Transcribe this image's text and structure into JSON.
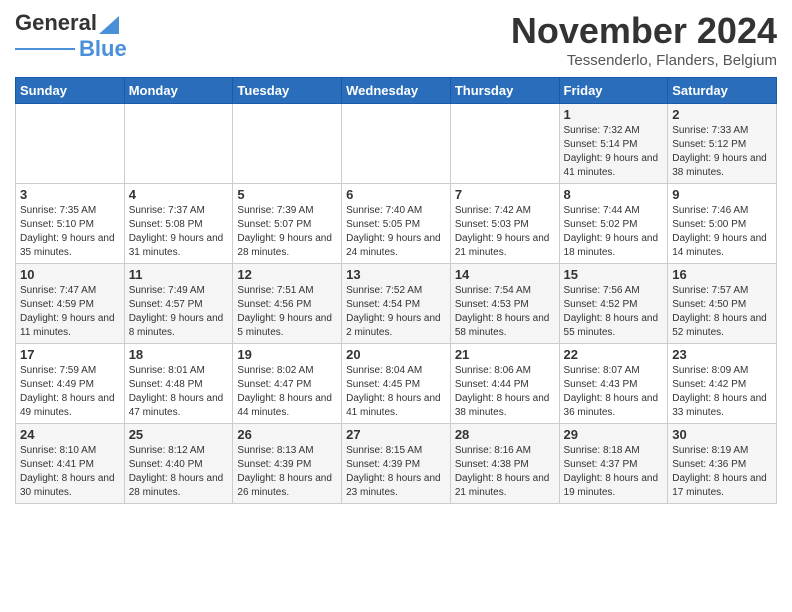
{
  "header": {
    "logo_general": "General",
    "logo_blue": "Blue",
    "month_title": "November 2024",
    "location": "Tessenderlo, Flanders, Belgium"
  },
  "days_of_week": [
    "Sunday",
    "Monday",
    "Tuesday",
    "Wednesday",
    "Thursday",
    "Friday",
    "Saturday"
  ],
  "weeks": [
    [
      {
        "day": "",
        "info": ""
      },
      {
        "day": "",
        "info": ""
      },
      {
        "day": "",
        "info": ""
      },
      {
        "day": "",
        "info": ""
      },
      {
        "day": "",
        "info": ""
      },
      {
        "day": "1",
        "info": "Sunrise: 7:32 AM\nSunset: 5:14 PM\nDaylight: 9 hours and 41 minutes."
      },
      {
        "day": "2",
        "info": "Sunrise: 7:33 AM\nSunset: 5:12 PM\nDaylight: 9 hours and 38 minutes."
      }
    ],
    [
      {
        "day": "3",
        "info": "Sunrise: 7:35 AM\nSunset: 5:10 PM\nDaylight: 9 hours and 35 minutes."
      },
      {
        "day": "4",
        "info": "Sunrise: 7:37 AM\nSunset: 5:08 PM\nDaylight: 9 hours and 31 minutes."
      },
      {
        "day": "5",
        "info": "Sunrise: 7:39 AM\nSunset: 5:07 PM\nDaylight: 9 hours and 28 minutes."
      },
      {
        "day": "6",
        "info": "Sunrise: 7:40 AM\nSunset: 5:05 PM\nDaylight: 9 hours and 24 minutes."
      },
      {
        "day": "7",
        "info": "Sunrise: 7:42 AM\nSunset: 5:03 PM\nDaylight: 9 hours and 21 minutes."
      },
      {
        "day": "8",
        "info": "Sunrise: 7:44 AM\nSunset: 5:02 PM\nDaylight: 9 hours and 18 minutes."
      },
      {
        "day": "9",
        "info": "Sunrise: 7:46 AM\nSunset: 5:00 PM\nDaylight: 9 hours and 14 minutes."
      }
    ],
    [
      {
        "day": "10",
        "info": "Sunrise: 7:47 AM\nSunset: 4:59 PM\nDaylight: 9 hours and 11 minutes."
      },
      {
        "day": "11",
        "info": "Sunrise: 7:49 AM\nSunset: 4:57 PM\nDaylight: 9 hours and 8 minutes."
      },
      {
        "day": "12",
        "info": "Sunrise: 7:51 AM\nSunset: 4:56 PM\nDaylight: 9 hours and 5 minutes."
      },
      {
        "day": "13",
        "info": "Sunrise: 7:52 AM\nSunset: 4:54 PM\nDaylight: 9 hours and 2 minutes."
      },
      {
        "day": "14",
        "info": "Sunrise: 7:54 AM\nSunset: 4:53 PM\nDaylight: 8 hours and 58 minutes."
      },
      {
        "day": "15",
        "info": "Sunrise: 7:56 AM\nSunset: 4:52 PM\nDaylight: 8 hours and 55 minutes."
      },
      {
        "day": "16",
        "info": "Sunrise: 7:57 AM\nSunset: 4:50 PM\nDaylight: 8 hours and 52 minutes."
      }
    ],
    [
      {
        "day": "17",
        "info": "Sunrise: 7:59 AM\nSunset: 4:49 PM\nDaylight: 8 hours and 49 minutes."
      },
      {
        "day": "18",
        "info": "Sunrise: 8:01 AM\nSunset: 4:48 PM\nDaylight: 8 hours and 47 minutes."
      },
      {
        "day": "19",
        "info": "Sunrise: 8:02 AM\nSunset: 4:47 PM\nDaylight: 8 hours and 44 minutes."
      },
      {
        "day": "20",
        "info": "Sunrise: 8:04 AM\nSunset: 4:45 PM\nDaylight: 8 hours and 41 minutes."
      },
      {
        "day": "21",
        "info": "Sunrise: 8:06 AM\nSunset: 4:44 PM\nDaylight: 8 hours and 38 minutes."
      },
      {
        "day": "22",
        "info": "Sunrise: 8:07 AM\nSunset: 4:43 PM\nDaylight: 8 hours and 36 minutes."
      },
      {
        "day": "23",
        "info": "Sunrise: 8:09 AM\nSunset: 4:42 PM\nDaylight: 8 hours and 33 minutes."
      }
    ],
    [
      {
        "day": "24",
        "info": "Sunrise: 8:10 AM\nSunset: 4:41 PM\nDaylight: 8 hours and 30 minutes."
      },
      {
        "day": "25",
        "info": "Sunrise: 8:12 AM\nSunset: 4:40 PM\nDaylight: 8 hours and 28 minutes."
      },
      {
        "day": "26",
        "info": "Sunrise: 8:13 AM\nSunset: 4:39 PM\nDaylight: 8 hours and 26 minutes."
      },
      {
        "day": "27",
        "info": "Sunrise: 8:15 AM\nSunset: 4:39 PM\nDaylight: 8 hours and 23 minutes."
      },
      {
        "day": "28",
        "info": "Sunrise: 8:16 AM\nSunset: 4:38 PM\nDaylight: 8 hours and 21 minutes."
      },
      {
        "day": "29",
        "info": "Sunrise: 8:18 AM\nSunset: 4:37 PM\nDaylight: 8 hours and 19 minutes."
      },
      {
        "day": "30",
        "info": "Sunrise: 8:19 AM\nSunset: 4:36 PM\nDaylight: 8 hours and 17 minutes."
      }
    ]
  ]
}
